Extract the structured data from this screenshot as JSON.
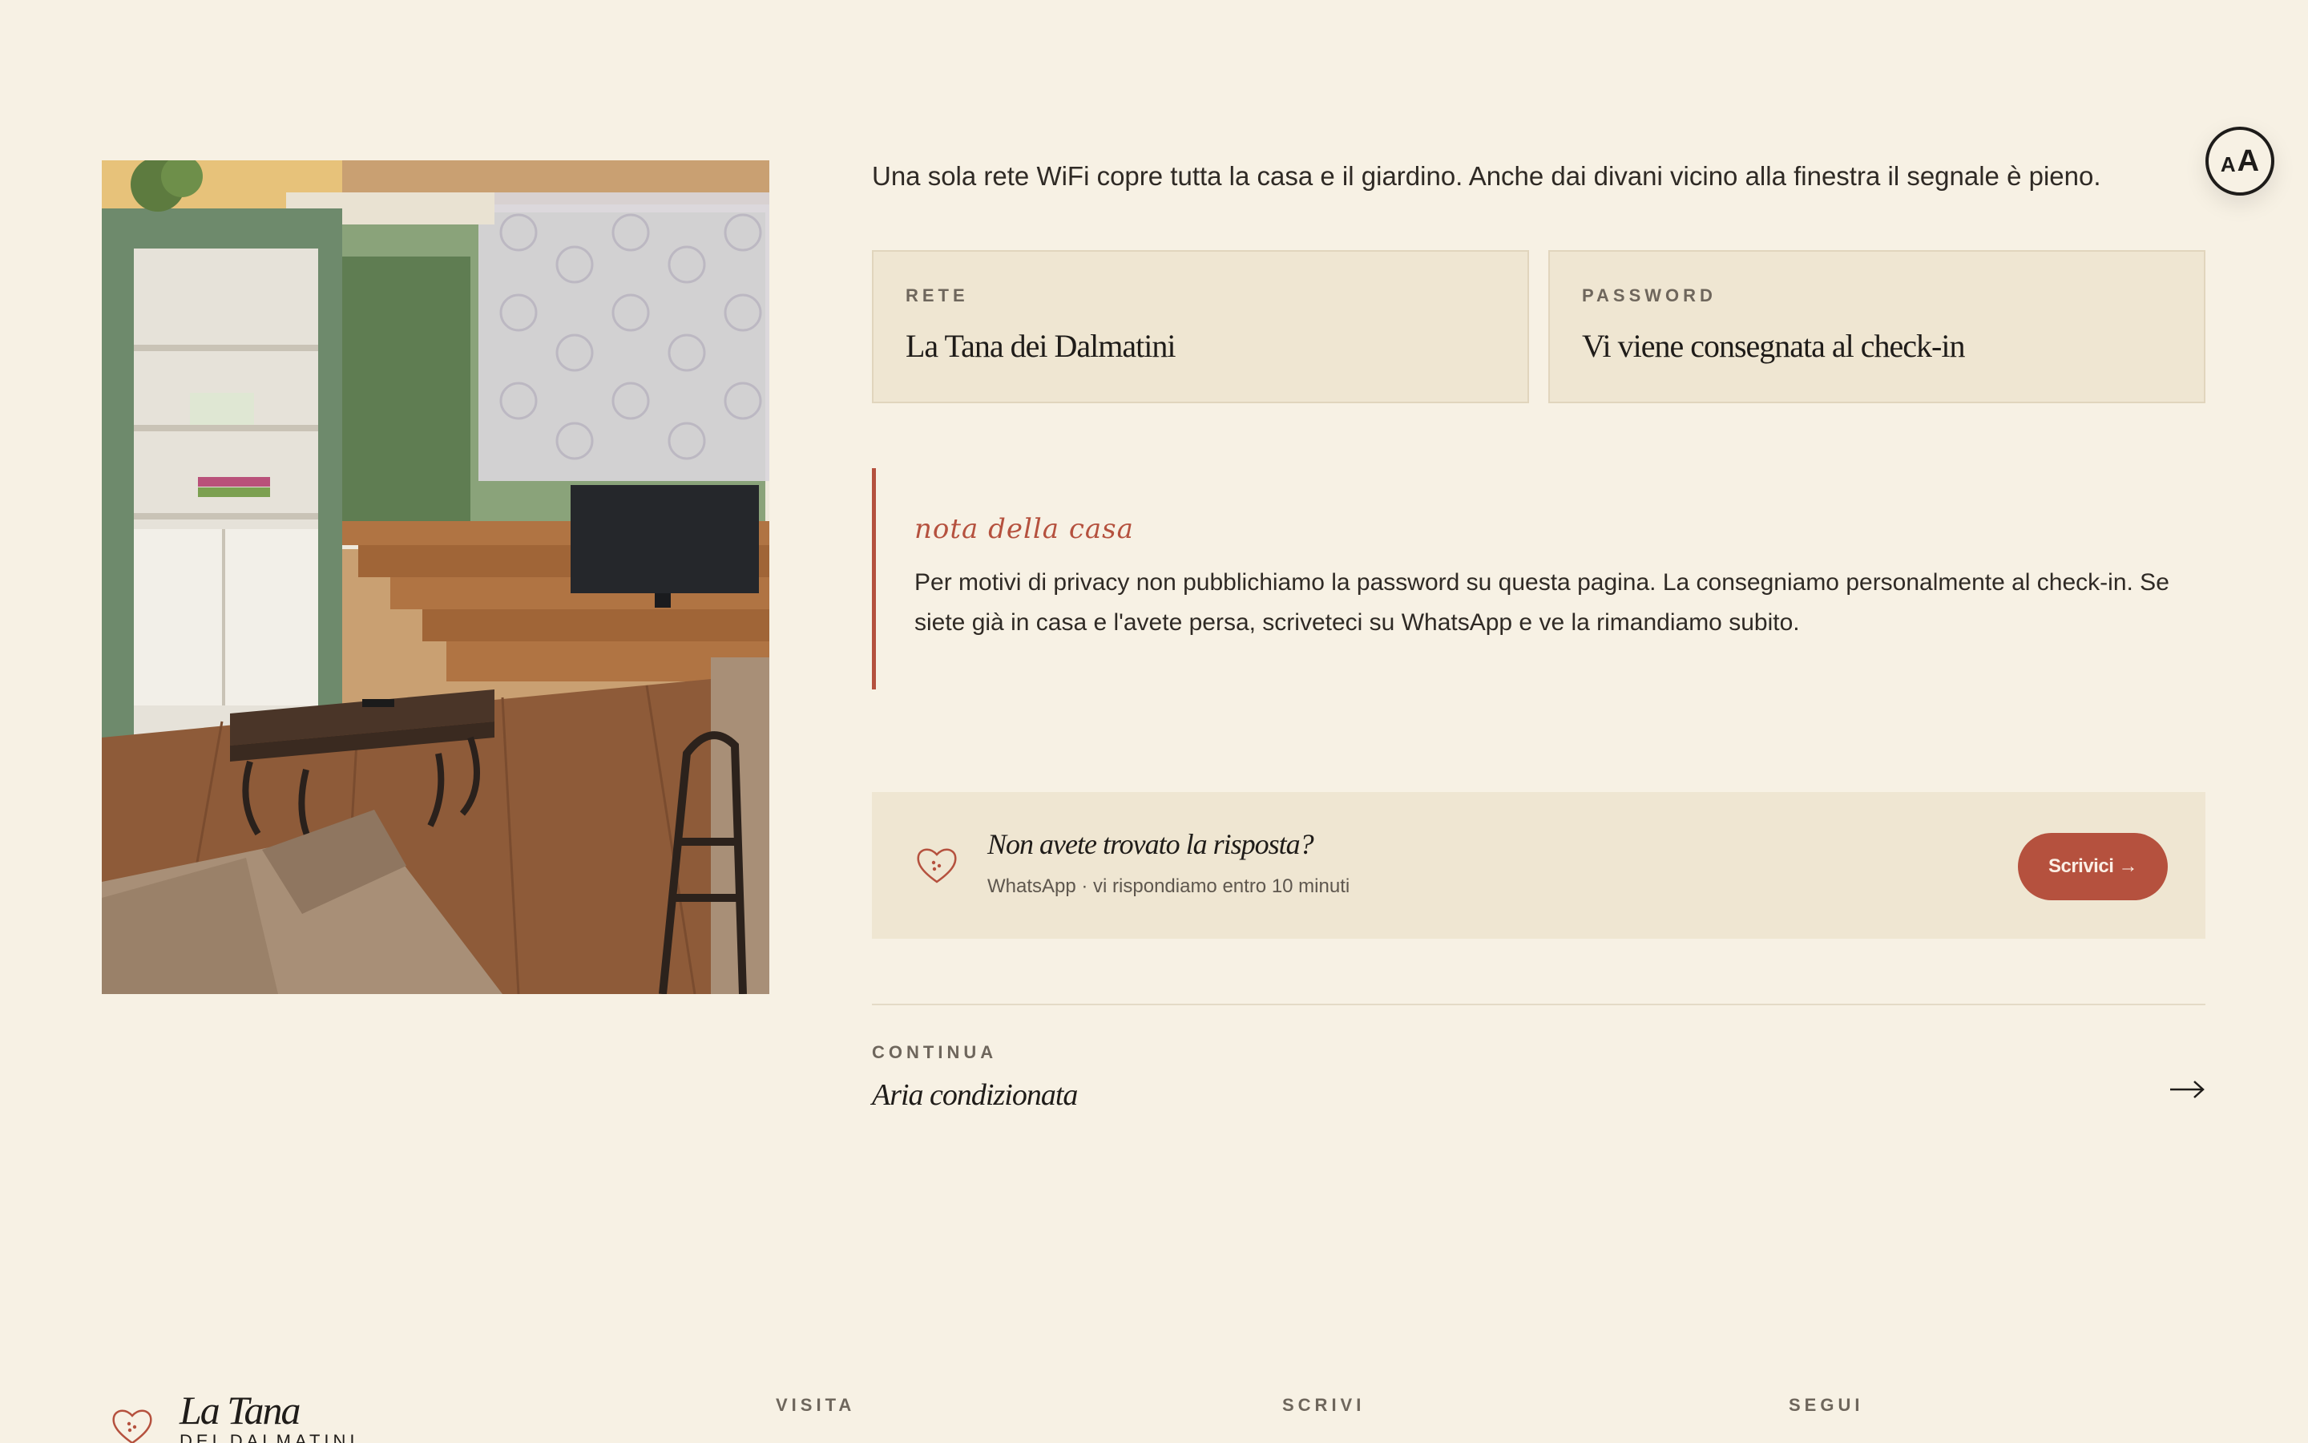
{
  "accessibility": {
    "small_glyph": "A",
    "large_glyph": "A"
  },
  "intro": "Una sola rete WiFi copre tutta la casa e il giardino. Anche dai divani vicino alla finestra il segnale è pieno.",
  "wifi": {
    "network_label": "RETE",
    "network_value": "La Tana dei Dalmatini",
    "password_label": "PASSWORD",
    "password_value": "Vi viene consegnata al check-in"
  },
  "note": {
    "title": "nota della casa",
    "body": "Per motivi di privacy non pubblichiamo la password su questa pagina. La consegniamo personalmente al check-in. Se siete già in casa e l'avete persa, scriveteci su WhatsApp e ve la rimandiamo subito."
  },
  "contact": {
    "question": "Non avete trovato la risposta?",
    "sub": "WhatsApp · vi rispondiamo entro 10 minuti",
    "button_label": "Scrivici →"
  },
  "continue": {
    "label": "CONTINUA",
    "next_title": "Aria condizionata"
  },
  "footer": {
    "logo_name": "La Tana",
    "logo_sub": "DEI DALMATINI",
    "columns": [
      "VISITA",
      "SCRIVI",
      "SEGUI"
    ]
  },
  "colors": {
    "background": "#f7f1e4",
    "card": "#efe6d2",
    "accent": "#b5513e",
    "text": "#2b2723"
  },
  "icons": [
    "heart-icon",
    "arrow-right-icon",
    "font-size-icon"
  ]
}
